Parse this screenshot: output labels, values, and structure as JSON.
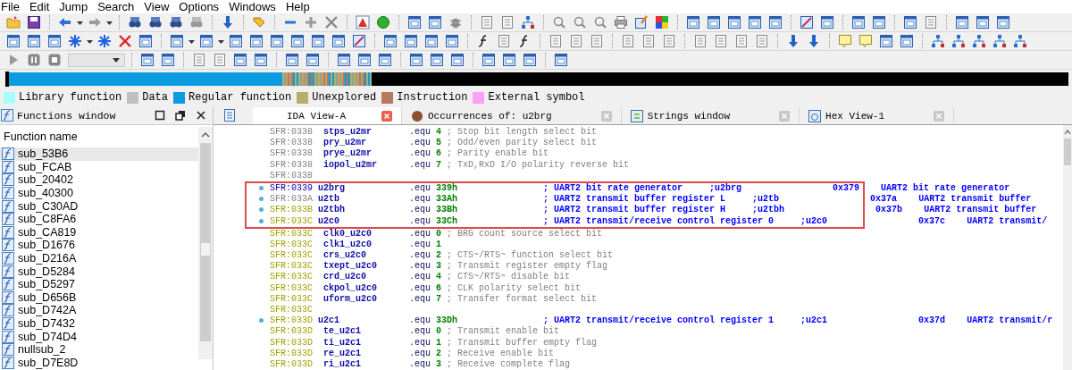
{
  "menu": [
    "File",
    "Edit",
    "Jump",
    "Search",
    "View",
    "Options",
    "Windows",
    "Help"
  ],
  "legend": [
    {
      "label": "Library function",
      "color": "#a8ffff"
    },
    {
      "label": "Data",
      "color": "#c0c0c0"
    },
    {
      "label": "Regular function",
      "color": "#0a9be0"
    },
    {
      "label": "Unexplored",
      "color": "#b4b06c"
    },
    {
      "label": "Instruction",
      "color": "#b47a5a"
    },
    {
      "label": "External symbol",
      "color": "#ffa0f4"
    }
  ],
  "functions_window": {
    "title": "Functions window",
    "column": "Function name",
    "items": [
      {
        "name": "sub_53B6",
        "selected": true
      },
      {
        "name": "sub_FCAB",
        "selected": false
      },
      {
        "name": "sub_20402",
        "selected": false
      },
      {
        "name": "sub_40300",
        "selected": false
      },
      {
        "name": "sub_C30AD",
        "selected": false
      },
      {
        "name": "sub_C8FA6",
        "selected": false
      },
      {
        "name": "sub_CA819",
        "selected": false
      },
      {
        "name": "sub_D1676",
        "selected": false
      },
      {
        "name": "sub_D216A",
        "selected": false
      },
      {
        "name": "sub_D5284",
        "selected": false
      },
      {
        "name": "sub_D5297",
        "selected": false
      },
      {
        "name": "sub_D656B",
        "selected": false
      },
      {
        "name": "sub_D742A",
        "selected": false
      },
      {
        "name": "sub_D7432",
        "selected": false
      },
      {
        "name": "sub_D74D4",
        "selected": false
      },
      {
        "name": "nullsub_2",
        "selected": false
      },
      {
        "name": "sub_D7E8D",
        "selected": false
      }
    ]
  },
  "tabs": [
    {
      "label": "IDA View-A",
      "kind": "disassembly",
      "selected": true
    },
    {
      "label": "Occurrences of: u2brg",
      "kind": "occurrences",
      "selected": false
    },
    {
      "label": "Strings window",
      "kind": "strings",
      "selected": false
    },
    {
      "label": "Hex View-1",
      "kind": "hex",
      "selected": false
    }
  ],
  "disassembly": {
    "lines": [
      {
        "kind": "member",
        "address": "SFR:0338",
        "color": "#808080",
        "name": "stps_u2mr",
        "directive": ".equ",
        "value": "4",
        "comment": "; Stop bit length select bit",
        "marked": false,
        "highlighted": false
      },
      {
        "kind": "member",
        "address": "SFR:0338",
        "color": "#808080",
        "name": "pry_u2mr",
        "directive": ".equ",
        "value": "5",
        "comment": "; Odd/even parity select bit",
        "marked": false,
        "highlighted": false
      },
      {
        "kind": "member",
        "address": "SFR:0338",
        "color": "#808080",
        "name": "prye_u2mr",
        "directive": ".equ",
        "value": "6",
        "comment": "; Parity enable bit",
        "marked": false,
        "highlighted": false
      },
      {
        "kind": "member",
        "address": "SFR:0338",
        "color": "#808080",
        "name": "iopol_u2mr",
        "directive": ".equ",
        "value": "7",
        "comment": "; TxD,RxD I/O polarity reverse bit",
        "marked": false,
        "highlighted": false
      },
      {
        "kind": "label",
        "address": "SFR:0338",
        "color": "#808080",
        "marked": false,
        "highlighted": false
      },
      {
        "kind": "register",
        "address": "SFR:0339",
        "color": "#0000a8",
        "name": "u2brg",
        "directive": ".equ",
        "value": "339h",
        "comment": "; UART2 bit rate generator",
        "ref": ";u2brg",
        "xref_address": "0x379",
        "xref_text": "UART2 bit rate generator",
        "marked": true,
        "highlighted": true
      },
      {
        "kind": "register",
        "address": "SFR:033A",
        "color": "#808080",
        "name": "u2tb",
        "directive": ".equ",
        "value": "33Ah",
        "comment": "; UART2 transmit buffer register L",
        "ref": ";u2tb",
        "xref_address": "0x37a",
        "xref_text": "UART2 transmit buffer",
        "marked": true,
        "highlighted": true
      },
      {
        "kind": "register",
        "address": "SFR:033B",
        "color": "#a0a000",
        "name": "u2tbh",
        "directive": ".equ",
        "value": "33Bh",
        "comment": "; UART2 transmit buffer register H",
        "ref": ";u2tbh",
        "xref_address": "0x37b",
        "xref_text": "UART2 transmit buffer",
        "marked": true,
        "highlighted": true
      },
      {
        "kind": "register",
        "address": "SFR:033C",
        "color": "#a0a000",
        "name": "u2c0",
        "directive": ".equ",
        "value": "33Ch",
        "comment": "; UART2 transmit/receive control register 0",
        "ref": ";u2c0",
        "xref_address": "0x37c",
        "xref_text": "UART2 transmit/",
        "marked": true,
        "highlighted": true
      },
      {
        "kind": "member",
        "address": "SFR:033C",
        "color": "#a0a000",
        "name": "clk0_u2c0",
        "directive": ".equ",
        "value": "0",
        "comment": "; BRG count source select bit",
        "marked": false,
        "highlighted": false
      },
      {
        "kind": "member",
        "address": "SFR:033C",
        "color": "#a0a000",
        "name": "clk1_u2c0",
        "directive": ".equ",
        "value": "1",
        "marked": false,
        "highlighted": false
      },
      {
        "kind": "member",
        "address": "SFR:033C",
        "color": "#a0a000",
        "name": "crs_u2c0",
        "directive": ".equ",
        "value": "2",
        "comment": "; CTS~/RTS~ function select bit",
        "marked": false,
        "highlighted": false
      },
      {
        "kind": "member",
        "address": "SFR:033C",
        "color": "#a0a000",
        "name": "txept_u2c0",
        "directive": ".equ",
        "value": "3",
        "comment": "; Transmit register empty flag",
        "marked": false,
        "highlighted": false
      },
      {
        "kind": "member",
        "address": "SFR:033C",
        "color": "#a0a000",
        "name": "crd_u2c0",
        "directive": ".equ",
        "value": "4",
        "comment": "; CTS~/RTS~ disable bit",
        "marked": false,
        "highlighted": false
      },
      {
        "kind": "member",
        "address": "SFR:033C",
        "color": "#a0a000",
        "name": "ckpol_u2c0",
        "directive": ".equ",
        "value": "6",
        "comment": "; CLK polarity select bit",
        "marked": false,
        "highlighted": false
      },
      {
        "kind": "member",
        "address": "SFR:033C",
        "color": "#a0a000",
        "name": "uform_u2c0",
        "directive": ".equ",
        "value": "7",
        "comment": "; Transfer format select bit",
        "marked": false,
        "highlighted": false
      },
      {
        "kind": "label",
        "address": "SFR:033C",
        "color": "#a0a000",
        "marked": false,
        "highlighted": false
      },
      {
        "kind": "register",
        "address": "SFR:033D",
        "color": "#a0a000",
        "name": "u2c1",
        "directive": ".equ",
        "value": "33Dh",
        "comment": "; UART2 transmit/receive control register 1",
        "ref": ";u2c1",
        "xref_address": "0x37d",
        "xref_text": "UART2 transmit/r",
        "marked": true,
        "highlighted": false
      },
      {
        "kind": "member",
        "address": "SFR:033D",
        "color": "#a0a000",
        "name": "te_u2c1",
        "directive": ".equ",
        "value": "0",
        "comment": "; Transmit enable bit",
        "marked": false,
        "highlighted": false
      },
      {
        "kind": "member",
        "address": "SFR:033D",
        "color": "#a0a000",
        "name": "ti_u2c1",
        "directive": ".equ",
        "value": "1",
        "comment": "; Transmit buffer empty flag",
        "marked": false,
        "highlighted": false
      },
      {
        "kind": "member",
        "address": "SFR:033D",
        "color": "#a0a000",
        "name": "re_u2c1",
        "directive": ".equ",
        "value": "2",
        "comment": "; Receive enable bit",
        "marked": false,
        "highlighted": false
      },
      {
        "kind": "member",
        "address": "SFR:033D",
        "color": "#a0a000",
        "name": "ri_u2c1",
        "directive": ".equ",
        "value": "3",
        "comment": "; Receive complete flag",
        "marked": false,
        "highlighted": false
      }
    ]
  }
}
